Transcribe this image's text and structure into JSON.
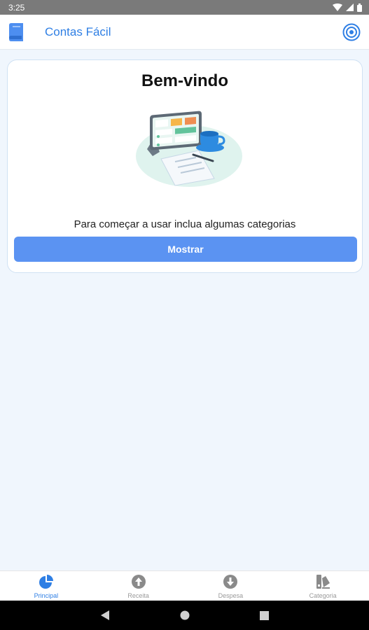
{
  "status_bar": {
    "time": "3:25"
  },
  "app_bar": {
    "title": "Contas Fácil"
  },
  "welcome": {
    "title": "Bem-vindo",
    "message": "Para começar a usar inclua algumas categorias",
    "button_label": "Mostrar"
  },
  "bottom_nav": {
    "items": [
      {
        "label": "Principal",
        "icon": "pie-chart-icon",
        "active": true
      },
      {
        "label": "Receita",
        "icon": "arrow-up-circle-icon",
        "active": false
      },
      {
        "label": "Despesa",
        "icon": "arrow-down-circle-icon",
        "active": false
      },
      {
        "label": "Categoria",
        "icon": "category-swatch-icon",
        "active": false
      }
    ]
  },
  "colors": {
    "accent": "#2f7fe4",
    "button": "#5b93f2",
    "background": "#f0f6fd",
    "inactive": "#9a9a9a"
  }
}
